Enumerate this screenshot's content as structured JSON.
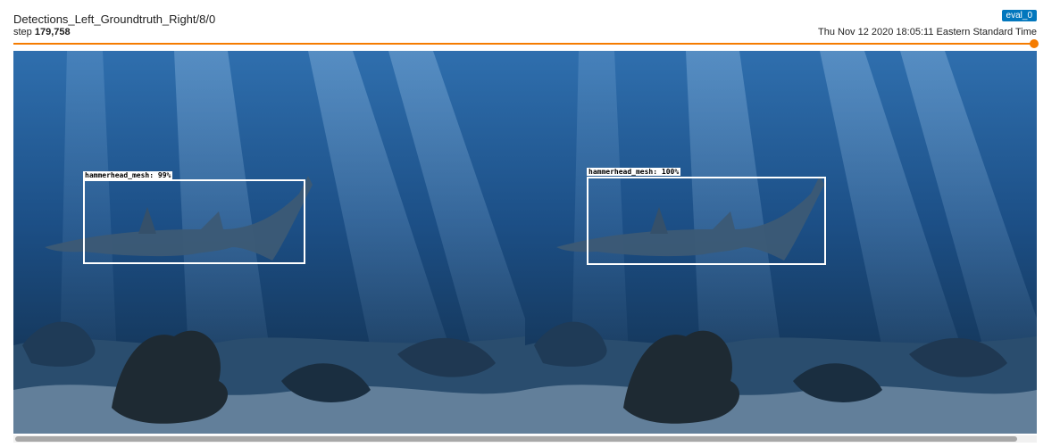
{
  "card": {
    "title": "Detections_Left_Groundtruth_Right/8/0",
    "run_badge": "eval_0",
    "step_label": "step",
    "step_value": "179,758",
    "timestamp": "Thu Nov 12 2020 18:05:11 Eastern Standard Time",
    "step_slider_position": 1.0
  },
  "image": {
    "left_panel": {
      "role": "detections",
      "label": "hammerhead_mesh: 99%"
    },
    "right_panel": {
      "role": "groundtruth",
      "label": "hammerhead_mesh: 100%"
    }
  },
  "colors": {
    "accent": "#f57c00",
    "badge": "#0277bd",
    "water_top": "#2d6aa6",
    "water_bottom": "#0b2036"
  }
}
